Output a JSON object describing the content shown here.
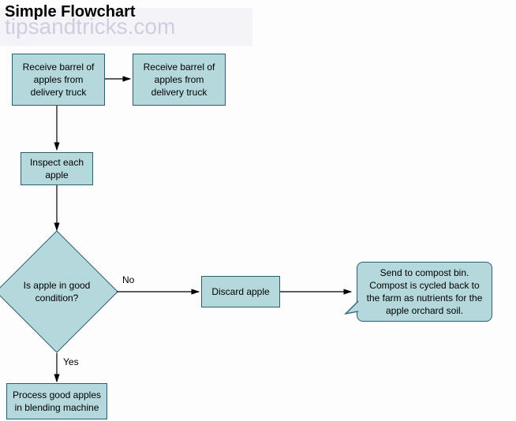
{
  "title": "Simple Flowchart",
  "watermark": "tipsandtricks.com",
  "nodes": {
    "receive1": "Receive barrel of apples from delivery truck",
    "receive2": "Receive barrel of apples from delivery truck",
    "inspect": "Inspect each apple",
    "decision": "Is apple in good condition?",
    "discard": "Discard apple",
    "process": "Process good apples in blending machine",
    "callout": "Send to compost bin. Compost is cycled back to the farm as nutrients for the apple orchard soil."
  },
  "labels": {
    "no": "No",
    "yes": "Yes"
  },
  "chart_data": {
    "type": "flowchart",
    "title": "Simple Flowchart",
    "nodes": [
      {
        "id": "receive1",
        "shape": "process",
        "text": "Receive barrel of apples from delivery truck"
      },
      {
        "id": "receive2",
        "shape": "process",
        "text": "Receive barrel of apples from delivery truck"
      },
      {
        "id": "inspect",
        "shape": "process",
        "text": "Inspect each apple"
      },
      {
        "id": "decision",
        "shape": "decision",
        "text": "Is apple in good condition?"
      },
      {
        "id": "discard",
        "shape": "process",
        "text": "Discard apple"
      },
      {
        "id": "process",
        "shape": "process",
        "text": "Process good apples in blending machine"
      },
      {
        "id": "callout",
        "shape": "callout",
        "text": "Send to compost bin. Compost is cycled back to the farm as nutrients for the apple orchard soil."
      }
    ],
    "edges": [
      {
        "from": "receive1",
        "to": "receive2",
        "label": ""
      },
      {
        "from": "receive1",
        "to": "inspect",
        "label": ""
      },
      {
        "from": "inspect",
        "to": "decision",
        "label": ""
      },
      {
        "from": "decision",
        "to": "discard",
        "label": "No"
      },
      {
        "from": "decision",
        "to": "process",
        "label": "Yes"
      },
      {
        "from": "discard",
        "to": "callout",
        "label": ""
      }
    ]
  }
}
